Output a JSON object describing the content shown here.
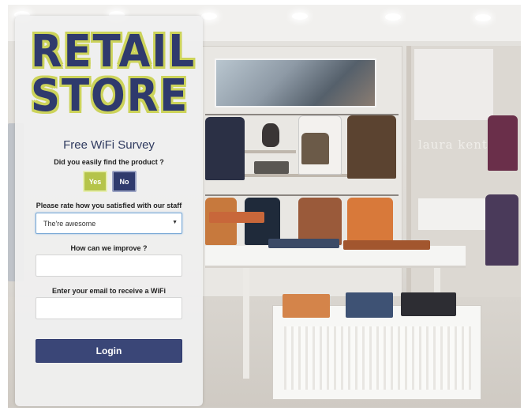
{
  "logo": {
    "line1": "RETAIL",
    "line2": "STORE",
    "text_color": "#2f3a6d",
    "outline_color": "#ccd35a"
  },
  "survey": {
    "title": "Free WiFi Survey",
    "question_find_product": "Did you easily find the product ?",
    "yes_label": "Yes",
    "no_label": "No",
    "question_rate": "Please rate how you satisfied with our staff",
    "rating_selected": "The're awesome",
    "question_improve": "How can we improve ?",
    "improve_value": "",
    "question_email": "Enter your email to receive a WiFi",
    "email_value": "",
    "login_label": "Login"
  },
  "background": {
    "store_sign_text": "laura kent"
  },
  "colors": {
    "accent_navy": "#2f3a6d",
    "accent_lime": "#b5c44a",
    "panel_bg": "#f0f0f0"
  }
}
